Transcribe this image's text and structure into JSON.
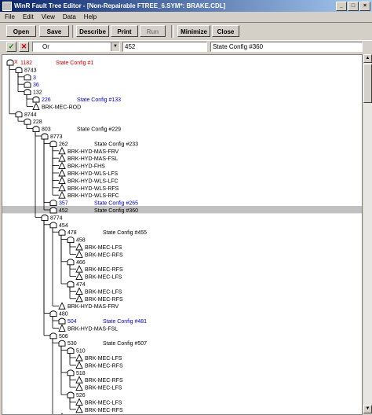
{
  "window": {
    "title": "WinR Fault Tree Editor - [Non-Repairable FTREE_6.SYM*: BRAKE.CDL]"
  },
  "menu": [
    "File",
    "Edit",
    "View",
    "Data",
    "Help"
  ],
  "toolbar": {
    "open": "Open",
    "save": "Save",
    "describe": "Describe",
    "print": "Print",
    "run": "Run",
    "minimize": "Minimize",
    "close": "Close"
  },
  "editor": {
    "ok": "✓",
    "cancel": "✕",
    "gate_type": "Or",
    "id_value": "452",
    "description_value": "State Config #360"
  },
  "tree": {
    "colors": {
      "selected": "#c0c0c0",
      "link": "#0000cc",
      "root": "#cc0000"
    },
    "nodes": [
      {
        "depth": 0,
        "type": "gate",
        "id": "1182",
        "label": "State Config #1",
        "style": "root",
        "prefix": "X"
      },
      {
        "depth": 1,
        "type": "gate",
        "id": "8743"
      },
      {
        "depth": 2,
        "type": "gate",
        "id": "3",
        "style": "link"
      },
      {
        "depth": 2,
        "type": "gate",
        "id": "36",
        "style": "link"
      },
      {
        "depth": 2,
        "type": "gate",
        "id": "132"
      },
      {
        "depth": 3,
        "type": "gate",
        "id": "226",
        "label": "State Config #133",
        "style": "link"
      },
      {
        "depth": 3,
        "type": "event",
        "id": "BRK-MEC-ROD"
      },
      {
        "depth": 1,
        "type": "gate",
        "id": "8744"
      },
      {
        "depth": 2,
        "type": "gate",
        "id": "228"
      },
      {
        "depth": 3,
        "type": "gate",
        "id": "803",
        "label": "State Config #229"
      },
      {
        "depth": 4,
        "type": "gate",
        "id": "8773"
      },
      {
        "depth": 5,
        "type": "gate",
        "id": "262",
        "label": "State Config #233"
      },
      {
        "depth": 6,
        "type": "event",
        "id": "BRK-HYD-MAS-FRV"
      },
      {
        "depth": 6,
        "type": "event",
        "id": "BRK-HYD-MAS-FSL"
      },
      {
        "depth": 6,
        "type": "event",
        "id": "BRK-HYD-FHS"
      },
      {
        "depth": 6,
        "type": "event",
        "id": "BRK-HYD-WLS-LFS"
      },
      {
        "depth": 6,
        "type": "event",
        "id": "BRK-HYD-WLS-LFC"
      },
      {
        "depth": 6,
        "type": "event",
        "id": "BRK-HYD-WLS-RFS"
      },
      {
        "depth": 6,
        "type": "event",
        "id": "BRK-HYD-WLS-RFC"
      },
      {
        "depth": 5,
        "type": "gate",
        "id": "357",
        "label": "State Config #265",
        "style": "link"
      },
      {
        "depth": 5,
        "type": "gate",
        "id": "452",
        "label": "State Config #360",
        "style": "selected"
      },
      {
        "depth": 4,
        "type": "gate",
        "id": "8774"
      },
      {
        "depth": 5,
        "type": "gate",
        "id": "454"
      },
      {
        "depth": 6,
        "type": "gate",
        "id": "478",
        "label": "State Config #455"
      },
      {
        "depth": 7,
        "type": "gate",
        "id": "458"
      },
      {
        "depth": 8,
        "type": "event",
        "id": "BRK-MEC-LFS"
      },
      {
        "depth": 8,
        "type": "event",
        "id": "BRK-MEC-RFS"
      },
      {
        "depth": 7,
        "type": "gate",
        "id": "466"
      },
      {
        "depth": 8,
        "type": "event",
        "id": "BRK-MEC-RFS"
      },
      {
        "depth": 8,
        "type": "event",
        "id": "BRK-MEC-LFS"
      },
      {
        "depth": 7,
        "type": "gate",
        "id": "474"
      },
      {
        "depth": 8,
        "type": "event",
        "id": "BRK-MEC-LFS"
      },
      {
        "depth": 8,
        "type": "event",
        "id": "BRK-MEC-RFS"
      },
      {
        "depth": 6,
        "type": "event",
        "id": "BRK-HYD-MAS-FRV"
      },
      {
        "depth": 5,
        "type": "gate",
        "id": "480"
      },
      {
        "depth": 6,
        "type": "gate",
        "id": "504",
        "label": "State Config #481",
        "style": "link"
      },
      {
        "depth": 6,
        "type": "event",
        "id": "BRK-HYD-MAS-FSL"
      },
      {
        "depth": 5,
        "type": "gate",
        "id": "506"
      },
      {
        "depth": 6,
        "type": "gate",
        "id": "530",
        "label": "State Config #507"
      },
      {
        "depth": 7,
        "type": "gate",
        "id": "510"
      },
      {
        "depth": 8,
        "type": "event",
        "id": "BRK-MEC-LFS"
      },
      {
        "depth": 8,
        "type": "event",
        "id": "BRK-MEC-RFS"
      },
      {
        "depth": 7,
        "type": "gate",
        "id": "518"
      },
      {
        "depth": 8,
        "type": "event",
        "id": "BRK-MEC-RFS"
      },
      {
        "depth": 8,
        "type": "event",
        "id": "BRK-MEC-LFS"
      },
      {
        "depth": 7,
        "type": "gate",
        "id": "526"
      },
      {
        "depth": 8,
        "type": "event",
        "id": "BRK-MEC-LFS"
      },
      {
        "depth": 8,
        "type": "event",
        "id": "BRK-MEC-RFS"
      },
      {
        "depth": 6,
        "type": "event",
        "id": "BRK-HYD-FHS"
      }
    ]
  }
}
